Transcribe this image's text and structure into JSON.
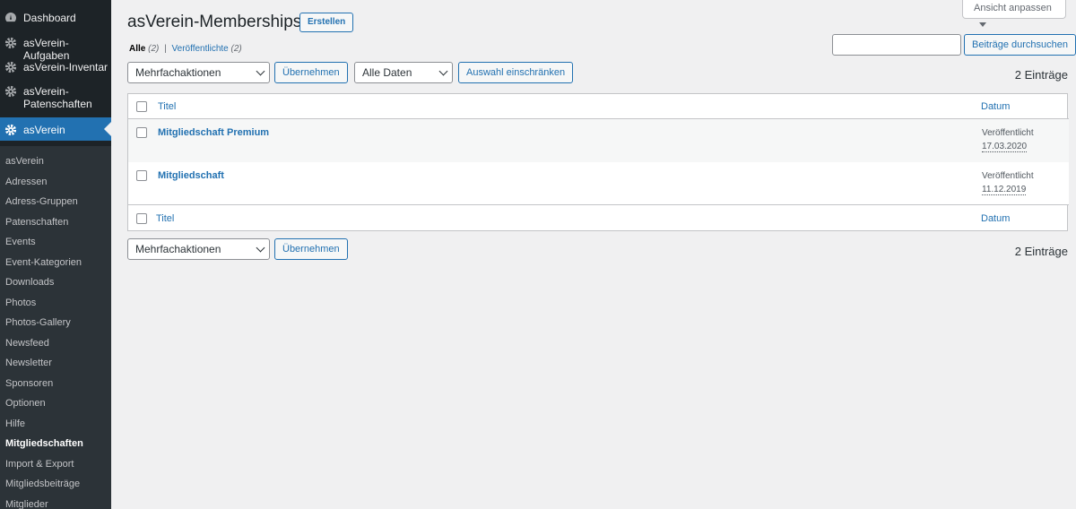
{
  "sidebar": {
    "top_items": [
      {
        "label": "Dashboard",
        "icon": "dashboard-icon"
      },
      {
        "label": "asVerein-Aufgaben",
        "icon": "gear-icon"
      },
      {
        "label": "asVerein-Inventar",
        "icon": "gear-icon"
      },
      {
        "label": "asVerein-Patenschaften",
        "icon": "gear-icon"
      },
      {
        "label": "asVerein",
        "icon": "gear-icon"
      }
    ],
    "sub_items": [
      "asVerein",
      "Adressen",
      "Adress-Gruppen",
      "Patenschaften",
      "Events",
      "Event-Kategorien",
      "Downloads",
      "Photos",
      "Photos-Gallery",
      "Newsfeed",
      "Newsletter",
      "Sponsoren",
      "Optionen",
      "Hilfe",
      "Mitgliedschaften",
      "Import & Export",
      "Mitgliedsbeiträge",
      "Mitglieder"
    ]
  },
  "header": {
    "title": "asVerein-Memberships",
    "create_label": "Erstellen",
    "screen_options_label": "Ansicht anpassen"
  },
  "filters": {
    "all_label": "Alle",
    "all_count": "(2)",
    "separator": "|",
    "published_label": "Veröffentlichte",
    "published_count": "(2)"
  },
  "search": {
    "value": "",
    "button_label": "Beiträge durchsuchen"
  },
  "toolbar": {
    "bulk_actions": "Mehrfachaktionen",
    "apply_label": "Übernehmen",
    "dates": "Alle Daten",
    "filter_label": "Auswahl einschränken",
    "count": "2 Einträge"
  },
  "table": {
    "col_title": "Titel",
    "col_date": "Datum",
    "rows": [
      {
        "title": "Mitgliedschaft Premium",
        "status": "Veröffentlicht",
        "date": "17.03.2020"
      },
      {
        "title": "Mitgliedschaft",
        "status": "Veröffentlicht",
        "date": "11.12.2019"
      }
    ]
  },
  "colors": {
    "accent": "#2271b1",
    "sidebar_bg": "#1d2327",
    "submenu_bg": "#2c3338"
  }
}
